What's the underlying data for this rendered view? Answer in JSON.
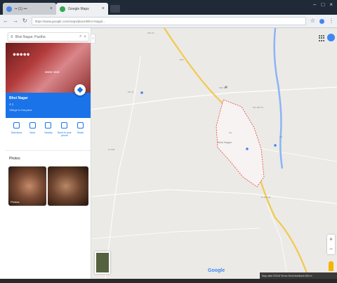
{
  "browser": {
    "tabs": [
      {
        "title": "•• (1) •••",
        "favicon_color": "#4a86e8"
      },
      {
        "title": "Google Maps",
        "favicon_color": "#34a853"
      }
    ],
    "url": "https://www.google.com/maps/place/Bhoi+Nagar..."
  },
  "panel": {
    "search_text": "Bhoi Nagar, Pastha",
    "hero_title": "•••••",
    "hero_sub": "••••• ••••",
    "place_name": "Bhoi Nagar",
    "place_sub": "4.1",
    "place_category": "Village in Haryana",
    "actions": [
      {
        "label": "Directions"
      },
      {
        "label": "Save"
      },
      {
        "label": "Nearby"
      },
      {
        "label": "Send to your phone"
      },
      {
        "label": "Share"
      }
    ],
    "photos_title": "Photos",
    "photo_caption": "Photos"
  },
  "map": {
    "labels": [
      {
        "text": "•••• ••"
      },
      {
        "text": "••••"
      },
      {
        "text": "•••• •••"
      },
      {
        "text": "••• •••• ••"
      },
      {
        "text": "Bhoi Nagar"
      },
      {
        "text": "•••"
      },
      {
        "text": "••• ••"
      },
      {
        "text": "•• ••••"
      },
      {
        "text": "•••"
      },
      {
        "text": "•• ••• •••"
      }
    ],
    "google_logo": "Google",
    "footer": "Map data ©2018  Terms  Send feedback  500 m",
    "colors": {
      "road": "#f2c94c",
      "river": "#8ab4f8",
      "boundary": "#ea4335",
      "land": "#ebeae6"
    }
  }
}
